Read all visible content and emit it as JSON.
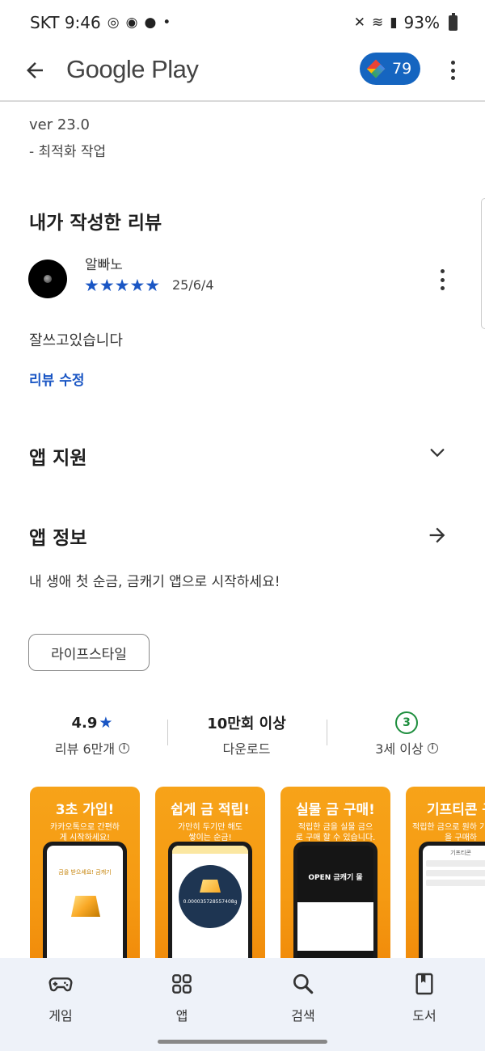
{
  "status_bar": {
    "carrier_time": "SKT 9:46",
    "battery": "93%"
  },
  "app_bar": {
    "title": "Google Play",
    "points": "79"
  },
  "whats_new": {
    "version": "ver 23.0",
    "note": "- 최적화 작업"
  },
  "my_review": {
    "title": "내가 작성한 리뷰",
    "reviewer": "알빠노",
    "rating": 5,
    "stars": "★★★★★",
    "date": "25/6/4",
    "text": "잘쓰고있습니다",
    "edit_label": "리뷰 수정"
  },
  "app_support": {
    "title": "앱 지원"
  },
  "app_info": {
    "title": "앱 정보",
    "description": "내 생애 첫 순금, 금캐기 앱으로 시작하세요!",
    "category": "라이프스타일"
  },
  "stats": {
    "rating_value": "4.9",
    "rating_label": "리뷰 6만개",
    "downloads_value": "10만회 이상",
    "downloads_label": "다운로드",
    "age_value": "3",
    "age_label": "3세 이상"
  },
  "screenshots": [
    {
      "title": "3초 가입!",
      "subtitle": "카카오톡으로 간편하게 시작하세요!",
      "screen_text": "금을 받으세요! 금캐기"
    },
    {
      "title": "쉽게 금 적립!",
      "subtitle": "가만히 두기만 해도 쌓이는 순금!",
      "screen_text": "0.0000357285574​08g"
    },
    {
      "title": "실물 금 구매!",
      "subtitle": "적립한 금을 실물 금으로 구매 할 수 있습니다.",
      "screen_text": "OPEN 금캐기 몰"
    },
    {
      "title": "기프티콘 구",
      "subtitle": "적립한 금으로 원하 기프티콘을 구매하",
      "screen_text": "기프티콘"
    }
  ],
  "bottom_nav": [
    {
      "label": "게임",
      "icon": "gamepad-icon"
    },
    {
      "label": "앱",
      "icon": "apps-grid-icon"
    },
    {
      "label": "검색",
      "icon": "search-icon"
    },
    {
      "label": "도서",
      "icon": "book-icon"
    }
  ]
}
